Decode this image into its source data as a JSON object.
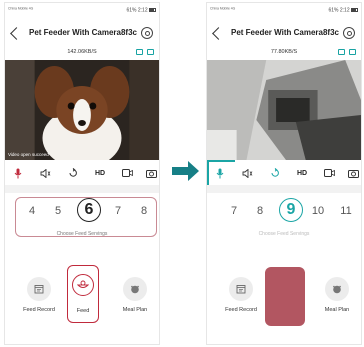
{
  "colors": {
    "accent_teal": "#1aa5a5",
    "alert_red": "#c02a3c",
    "feed_fill": "#b25661",
    "arrow": "#167f86"
  },
  "left": {
    "status": {
      "carrier": "China Mobile 4G",
      "right": "61%  2:12"
    },
    "title": "Pet Feeder With Camera8f3c",
    "speed": "142.06KB/S",
    "video_message": "Video open succeed",
    "controls": {
      "hd": "HD"
    },
    "picker": {
      "numbers": [
        "4",
        "5",
        "6",
        "7",
        "8"
      ],
      "selected": "6",
      "caption": "Choose Feed Servings"
    },
    "actions": {
      "record": "Feed Record",
      "feed": "Feed",
      "plan": "Meal Plan"
    }
  },
  "right": {
    "status": {
      "carrier": "China Mobile 4G",
      "right": "61%  2:12"
    },
    "title": "Pet Feeder With Camera8f3c",
    "speed": "77.80KB/S",
    "controls": {
      "hd": "HD"
    },
    "picker": {
      "numbers": [
        "7",
        "8",
        "9",
        "10",
        "11"
      ],
      "selected": "9",
      "caption": "Choose Feed Servings"
    },
    "actions": {
      "record": "Feed Record",
      "plan": "Meal Plan"
    }
  },
  "icons": {
    "back": "chevron-left-icon",
    "settings": "gear-icon",
    "mic": "microphone-icon",
    "speaker": "speaker-icon",
    "rotate": "rotate-icon",
    "record": "video-record-icon",
    "snapshot": "camera-icon",
    "feed_record": "calendar-icon",
    "feed": "bowl-icon",
    "meal_plan": "pet-face-icon",
    "transition": "arrow-right-icon"
  }
}
